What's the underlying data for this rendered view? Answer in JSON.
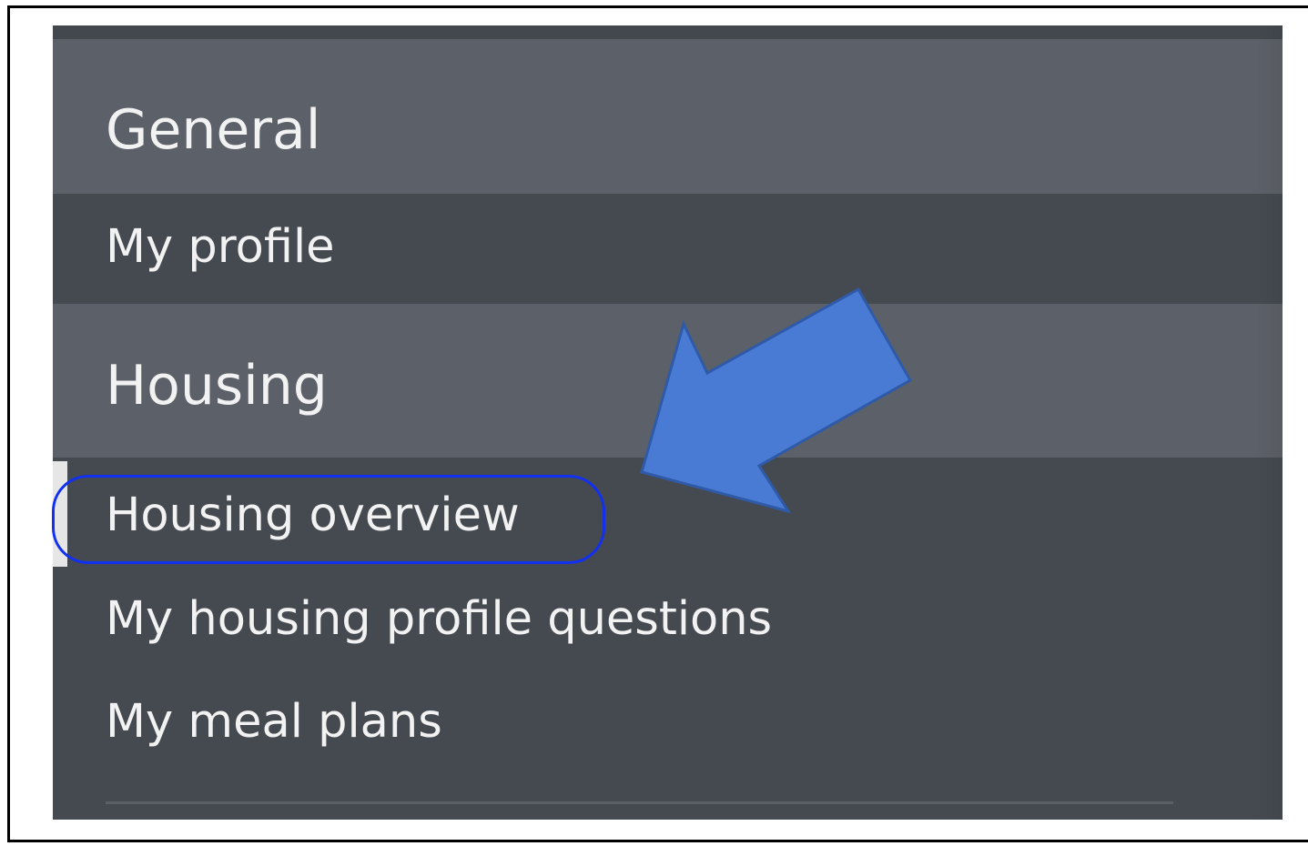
{
  "menu": {
    "sections": [
      {
        "header": "General",
        "items": [
          "My profile"
        ]
      },
      {
        "header": "Housing",
        "items": [
          "Housing overview",
          "My housing profile questions",
          "My meal plans"
        ]
      }
    ],
    "active_item": "Housing overview"
  },
  "annotation": {
    "highlight_color": "#1230f0",
    "arrow_color": "#4a7bd4",
    "arrow_target": "Housing overview"
  },
  "colors": {
    "panel_background": "#454a51",
    "section_header_background": "#5c6068",
    "text": "#f2f2f2",
    "active_indicator": "#e6e6e6"
  }
}
